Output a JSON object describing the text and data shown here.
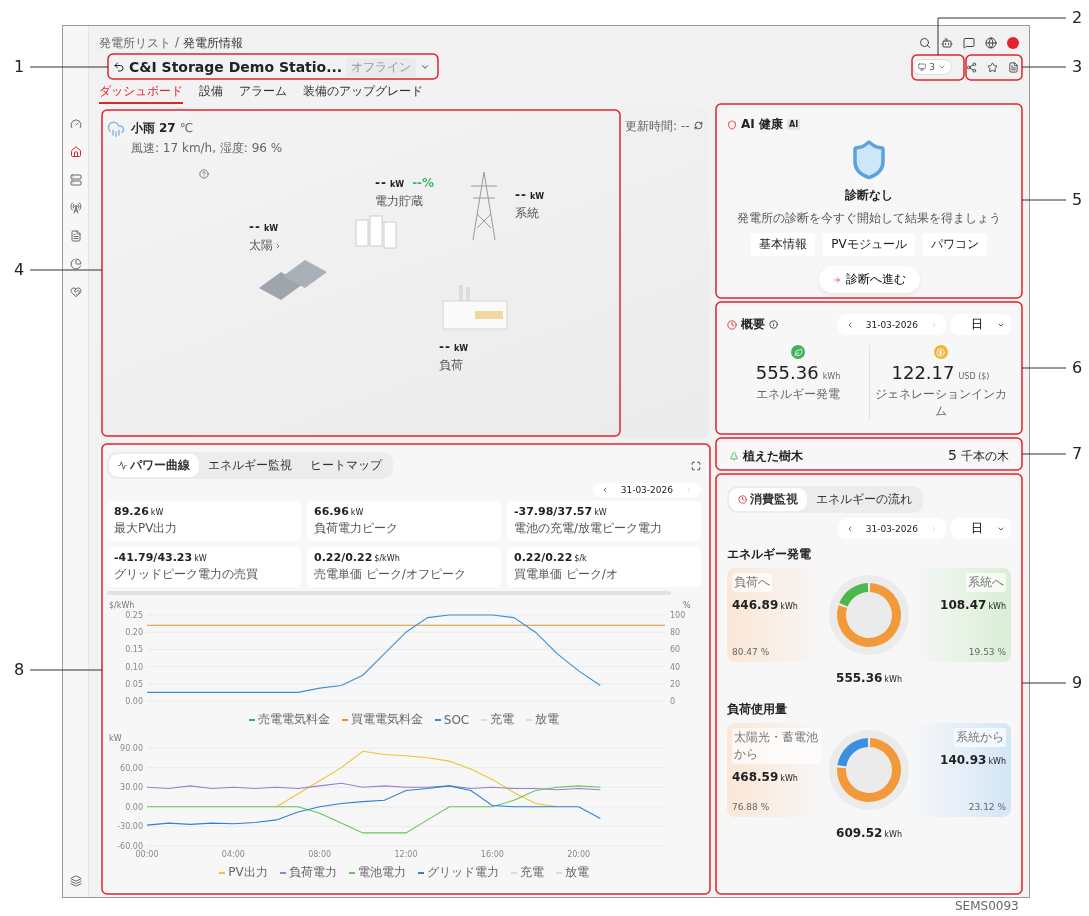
{
  "breadcrumb": {
    "items": [
      "発電所リスト",
      "発電所情報"
    ],
    "separator": "/"
  },
  "station": {
    "title": "C&I Storage Demo Statio...",
    "status": "オフライン"
  },
  "page_tabs": [
    {
      "label": "ダッシュボード",
      "selected": true
    },
    {
      "label": "設備",
      "selected": false
    },
    {
      "label": "アラーム",
      "selected": false
    },
    {
      "label": "装備のアップグレード",
      "selected": false
    }
  ],
  "device_chip": {
    "count": "3"
  },
  "sidebar": {
    "items": [
      {
        "selected": false
      },
      {
        "selected": true
      },
      {
        "selected": false
      },
      {
        "selected": false
      },
      {
        "selected": false
      },
      {
        "selected": false
      },
      {
        "selected": false
      }
    ]
  },
  "scene": {
    "weather": {
      "condition": "小雨",
      "temperature": "27",
      "unit": "℃",
      "details": "風速: 17 km/h, 湿度: 96 %"
    },
    "update_time": "更新時間: --",
    "nodes": [
      {
        "kind": "solar",
        "value": "--",
        "unit": "kW",
        "label": "太陽"
      },
      {
        "kind": "storage",
        "value": "--",
        "unit": "kW",
        "percent": "--%",
        "label": "電力貯蔵"
      },
      {
        "kind": "grid",
        "value": "--",
        "unit": "kW",
        "label": "系統"
      },
      {
        "kind": "load",
        "value": "--",
        "unit": "kW",
        "label": "負荷"
      }
    ]
  },
  "ai_health": {
    "title": "AI 健康",
    "badge": "AI",
    "status": "診断なし",
    "message": "発電所の診断を今すぐ開始して結果を得ましょう",
    "tags": [
      "基本情報",
      "PVモジュール",
      "パワコン"
    ],
    "button": "診断へ進む"
  },
  "summary": {
    "title": "概要",
    "date": "31-03-2026",
    "period": "日",
    "stats": [
      {
        "kind": "energy",
        "value": "555.36",
        "unit": "kWh",
        "label": "エネルギー発電"
      },
      {
        "kind": "income",
        "value": "122.17",
        "unit": "USD ($)",
        "label": "ジェネレーションインカム"
      }
    ]
  },
  "trees": {
    "label": "植えた樹木",
    "value": "5",
    "unit": "千本の木"
  },
  "power": {
    "tabs": [
      {
        "label": "パワー曲線",
        "selected": true
      },
      {
        "label": "エネルギー監視",
        "selected": false
      },
      {
        "label": "ヒートマップ",
        "selected": false
      }
    ],
    "date": "31-03-2026",
    "metrics": [
      {
        "value": "89.26",
        "unit": "kW",
        "label": "最大PV出力"
      },
      {
        "value": "66.96",
        "unit": "kW",
        "label": "負荷電力ピーク"
      },
      {
        "value": "-37.98/37.57",
        "unit": "kW",
        "label": "電池の充電/放電ピーク電力"
      },
      {
        "value": "-41.79/43.23",
        "unit": "kW",
        "label": "グリッドピーク電力の売買"
      },
      {
        "value": "0.22/0.22",
        "unit": "$/kWh",
        "label": "売電単価 ピーク/オフピーク"
      },
      {
        "value": "0.22/0.22",
        "unit": "$/k",
        "label": "買電単価 ピーク/オ"
      }
    ],
    "price_chart": {
      "band_legend": [
        "充電",
        "放電"
      ],
      "chart_data": {
        "type": "line",
        "ylabel": "$/kWh",
        "y2label": "%",
        "grid": true,
        "x": [
          0,
          1,
          2,
          3,
          4,
          5,
          6,
          7,
          8,
          9,
          10,
          11,
          12,
          13,
          14,
          15,
          16,
          17,
          18,
          19,
          20,
          21,
          22,
          23,
          24
        ],
        "xlim": [
          0,
          24
        ],
        "ylim": [
          0,
          0.25
        ],
        "y2lim": [
          0,
          100
        ],
        "yticks": [
          {
            "value": 0,
            "label": "0.00"
          },
          {
            "value": 0.05,
            "label": "0.05"
          },
          {
            "value": 0.1,
            "label": "0.10"
          },
          {
            "value": 0.15,
            "label": "0.15"
          },
          {
            "value": 0.2,
            "label": "0.20"
          },
          {
            "value": 0.25,
            "label": "0.25"
          }
        ],
        "y2ticks": [
          0,
          20,
          40,
          60,
          80,
          100
        ],
        "series": [
          {
            "name": "売電電気料金",
            "color": "#3fae5a",
            "values": [
              null,
              null,
              null,
              null,
              null,
              null,
              null,
              null,
              null,
              null,
              null,
              null,
              null,
              null,
              null,
              null,
              null,
              null,
              null,
              null,
              null,
              null,
              null,
              null,
              null
            ]
          },
          {
            "name": "買電電気料金",
            "color": "#e0922f",
            "values": [
              0.22,
              0.22,
              0.22,
              0.22,
              0.22,
              0.22,
              0.22,
              0.22,
              0.22,
              0.22,
              0.22,
              0.22,
              0.22,
              0.22,
              0.22,
              0.22,
              0.22,
              0.22,
              0.22,
              0.22,
              0.22,
              0.22,
              0.22,
              0.22,
              0.22
            ]
          },
          {
            "name": "SOC",
            "color": "#3b8fd8",
            "axis": "y2",
            "values": [
              10,
              10,
              10,
              10,
              10,
              10,
              10,
              10,
              15,
              18,
              30,
              55,
              80,
              97,
              100,
              100,
              100,
              97,
              80,
              55,
              35,
              18,
              null,
              null,
              null
            ]
          }
        ]
      }
    },
    "power_chart": {
      "band_legend": [
        "充電",
        "放電"
      ],
      "chart_data": {
        "type": "line",
        "ylabel": "kW",
        "grid": true,
        "x": [
          0,
          1,
          2,
          3,
          4,
          5,
          6,
          7,
          8,
          9,
          10,
          11,
          12,
          13,
          14,
          15,
          16,
          17,
          18,
          19,
          20,
          21
        ],
        "xlim": [
          0,
          24
        ],
        "ylim": [
          -60,
          90
        ],
        "yticks": [
          {
            "value": -60,
            "label": "-60.00"
          },
          {
            "value": -30,
            "label": "-30.00"
          },
          {
            "value": 0,
            "label": "0.00"
          },
          {
            "value": 30,
            "label": "30.00"
          },
          {
            "value": 60,
            "label": "60.00"
          },
          {
            "value": 90,
            "label": "90.00"
          }
        ],
        "xticks": [
          {
            "value": 0,
            "label": "00:00"
          },
          {
            "value": 4,
            "label": "04:00"
          },
          {
            "value": 8,
            "label": "08:00"
          },
          {
            "value": 12,
            "label": "12:00"
          },
          {
            "value": 16,
            "label": "16:00"
          },
          {
            "value": 20,
            "label": "20:00"
          }
        ],
        "series": [
          {
            "name": "PV出力",
            "color": "#f2c230",
            "values": [
              null,
              null,
              null,
              null,
              null,
              null,
              0,
              20,
              40,
              60,
              85,
              80,
              78,
              75,
              70,
              58,
              42,
              22,
              5,
              0,
              null,
              null
            ]
          },
          {
            "name": "負荷電力",
            "color": "#9a7fd0",
            "values": [
              30,
              28,
              32,
              28,
              30,
              28,
              30,
              28,
              32,
              36,
              30,
              32,
              30,
              30,
              32,
              28,
              30,
              28,
              28,
              26,
              28,
              26
            ]
          },
          {
            "name": "電池電力",
            "color": "#6cc25a",
            "values": [
              0,
              0,
              0,
              0,
              0,
              0,
              0,
              0,
              -10,
              -25,
              -40,
              -40,
              -40,
              -20,
              0,
              0,
              0,
              10,
              25,
              30,
              32,
              30
            ]
          },
          {
            "name": "グリッド電力",
            "color": "#2f7fd6",
            "values": [
              -28,
              -25,
              -27,
              -25,
              -26,
              -24,
              -20,
              -8,
              0,
              5,
              8,
              10,
              25,
              28,
              32,
              25,
              2,
              0,
              0,
              0,
              0,
              -18
            ]
          }
        ]
      }
    }
  },
  "consumption": {
    "tabs": [
      {
        "label": "消費監視",
        "selected": true
      },
      {
        "label": "エネルギーの流れ",
        "selected": false
      }
    ],
    "date": "31-03-2026",
    "period": "日",
    "sections": [
      {
        "title": "エネルギー発電",
        "left": {
          "label": "負荷へ",
          "value": "446.89",
          "unit": "kWh",
          "percent": "80.47 %"
        },
        "right": {
          "label": "系統へ",
          "value": "108.47",
          "unit": "kWh",
          "percent": "19.53 %"
        },
        "total": {
          "value": "555.36",
          "unit": "kWh"
        },
        "chart_data": {
          "type": "donut",
          "values": [
            80.47,
            19.53
          ],
          "colors": [
            "#f2993a",
            "#4cb84c"
          ]
        }
      },
      {
        "title": "負荷使用量",
        "left": {
          "label": "太陽光・蓄電池から",
          "value": "468.59",
          "unit": "kWh",
          "percent": "76.88 %"
        },
        "right": {
          "label": "系統から",
          "value": "140.93",
          "unit": "kWh",
          "percent": "23.12 %"
        },
        "total": {
          "value": "609.52",
          "unit": "kWh"
        },
        "chart_data": {
          "type": "donut",
          "values": [
            76.88,
            23.12
          ],
          "colors": [
            "#f2993a",
            "#3a8fe0"
          ]
        }
      }
    ]
  },
  "callouts": [
    "1",
    "4",
    "8",
    "2",
    "3",
    "5",
    "6",
    "7",
    "9"
  ],
  "figure_id": "SEMS0093"
}
